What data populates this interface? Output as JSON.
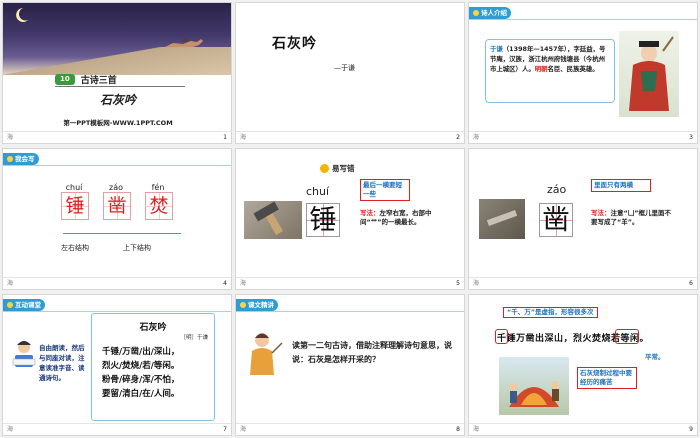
{
  "slides": [
    {
      "number": "1",
      "title_badge": "10",
      "title_main": "古诗三首",
      "subtitle": "石灰吟",
      "footer_brand": "第一PPT模板网-WWW.1PPT.COM"
    },
    {
      "number": "2",
      "poem_title": "石灰吟",
      "author": "—于谦"
    },
    {
      "number": "3",
      "section_label": "诗人介绍",
      "bio_name": "于谦",
      "bio_text": "（1398年—1457年），字廷益，号节庵，汉族，浙江杭州府钱塘县（今杭州市上城区）人。",
      "bio_emphasis": "明朝",
      "bio_tail": "名臣、民族英雄。"
    },
    {
      "number": "4",
      "section_label": "我会写",
      "chars": [
        {
          "pinyin": "chuí",
          "char": "锤"
        },
        {
          "pinyin": "záo",
          "char": "凿"
        },
        {
          "pinyin": "fén",
          "char": "焚"
        }
      ],
      "structure_left": "左右结构",
      "structure_right": "上下结构"
    },
    {
      "number": "5",
      "section_label": "易写错",
      "pinyin": "chuí",
      "char": "锤",
      "callout": "最后一横要短一些",
      "tip_label": "写法：",
      "tip_text": "左窄右宽，右部中间“艹”的一横最长。"
    },
    {
      "number": "6",
      "pinyin": "záo",
      "char": "凿",
      "callout": "里面只有两横",
      "tip_label": "写法：",
      "tip_text": "注意“凵”框儿里面不要写成了“羊”。"
    },
    {
      "number": "7",
      "section_label": "互动课堂",
      "side_text": "自由朗读，然后与同座对读，注意读准字音、读通诗句。",
      "poem_title": "石灰吟",
      "poem_author": "［明］于谦",
      "poem_lines": [
        "千锤/万凿/出/深山，",
        "烈火/焚烧/若/等闲。",
        "粉骨/碎身/浑/不怕，",
        "要留/清白/在/人间。"
      ]
    },
    {
      "number": "8",
      "section_label": "课文精讲",
      "question": "读第一二句古诗，借助注释理解诗句意思，说说：石灰是怎样开采的？"
    },
    {
      "number": "9",
      "note_top": "“千、万”是虚指，形容很多次",
      "poem_line": "千锤万凿出深山，烈火焚烧若等闲。",
      "circle_char": "锤",
      "circle_word": "等闲",
      "side_note": "平常。",
      "note_bottom": "石灰烧制过程中要经历的痛苦"
    }
  ],
  "corner_label": "海"
}
